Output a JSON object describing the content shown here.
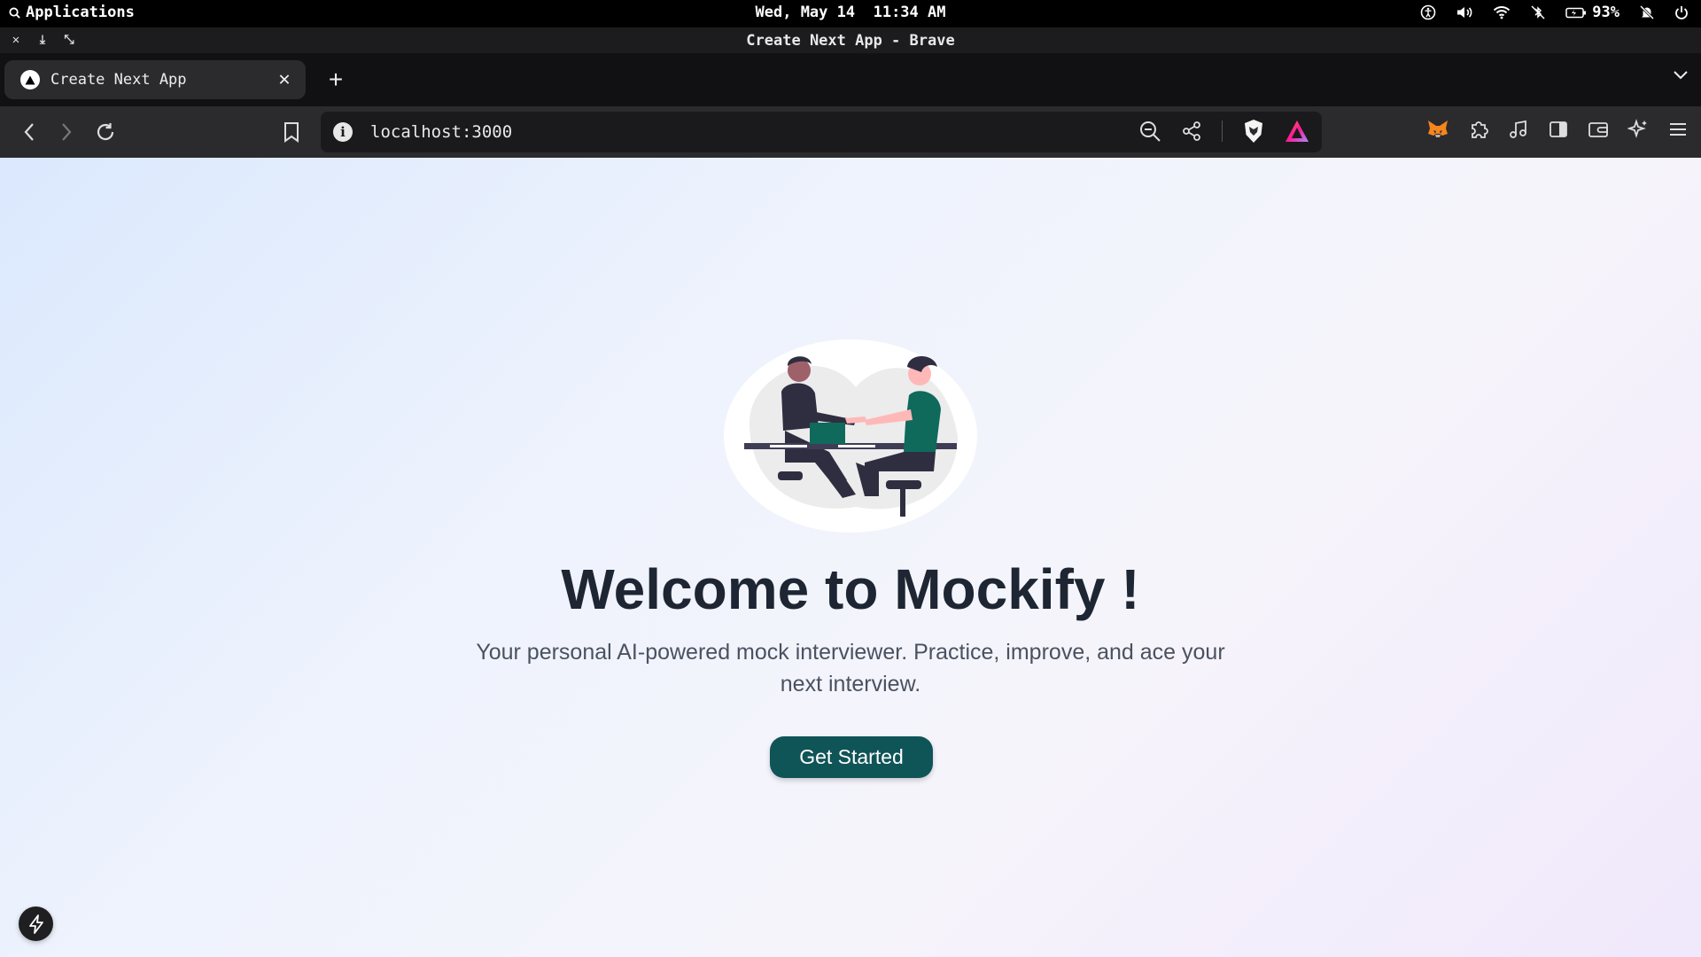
{
  "os_bar": {
    "apps_label": "Applications",
    "date": "Wed, May 14",
    "time": "11:34 AM",
    "battery_percent": "93%"
  },
  "window": {
    "title": "Create Next App - Brave"
  },
  "tabs": [
    {
      "label": "Create Next App",
      "active": true
    }
  ],
  "toolbar": {
    "url": "localhost:3000"
  },
  "page": {
    "title": "Welcome to Mockify !",
    "subtitle": "Your personal AI-powered mock interviewer. Practice, improve, and ace your next interview.",
    "cta_label": "Get Started"
  },
  "colors": {
    "cta_bg": "#0f5457",
    "title_text": "#1e2533",
    "shirt_teal": "#0f6a5c",
    "dark_figure": "#2f2e41"
  },
  "icons": [
    "search-icon",
    "accessibility-icon",
    "volume-icon",
    "wifi-icon",
    "bluetooth-off-icon",
    "battery-icon",
    "notifications-off-icon",
    "power-icon",
    "back-icon",
    "forward-icon",
    "reload-icon",
    "bookmark-icon",
    "info-icon",
    "zoom-out-icon",
    "share-icon",
    "brave-shields-icon",
    "brave-rewards-icon",
    "metamask-icon",
    "extensions-icon",
    "music-icon",
    "sidebar-icon",
    "wallet-icon",
    "leo-ai-icon",
    "menu-icon",
    "nextjs-dev-icon"
  ]
}
